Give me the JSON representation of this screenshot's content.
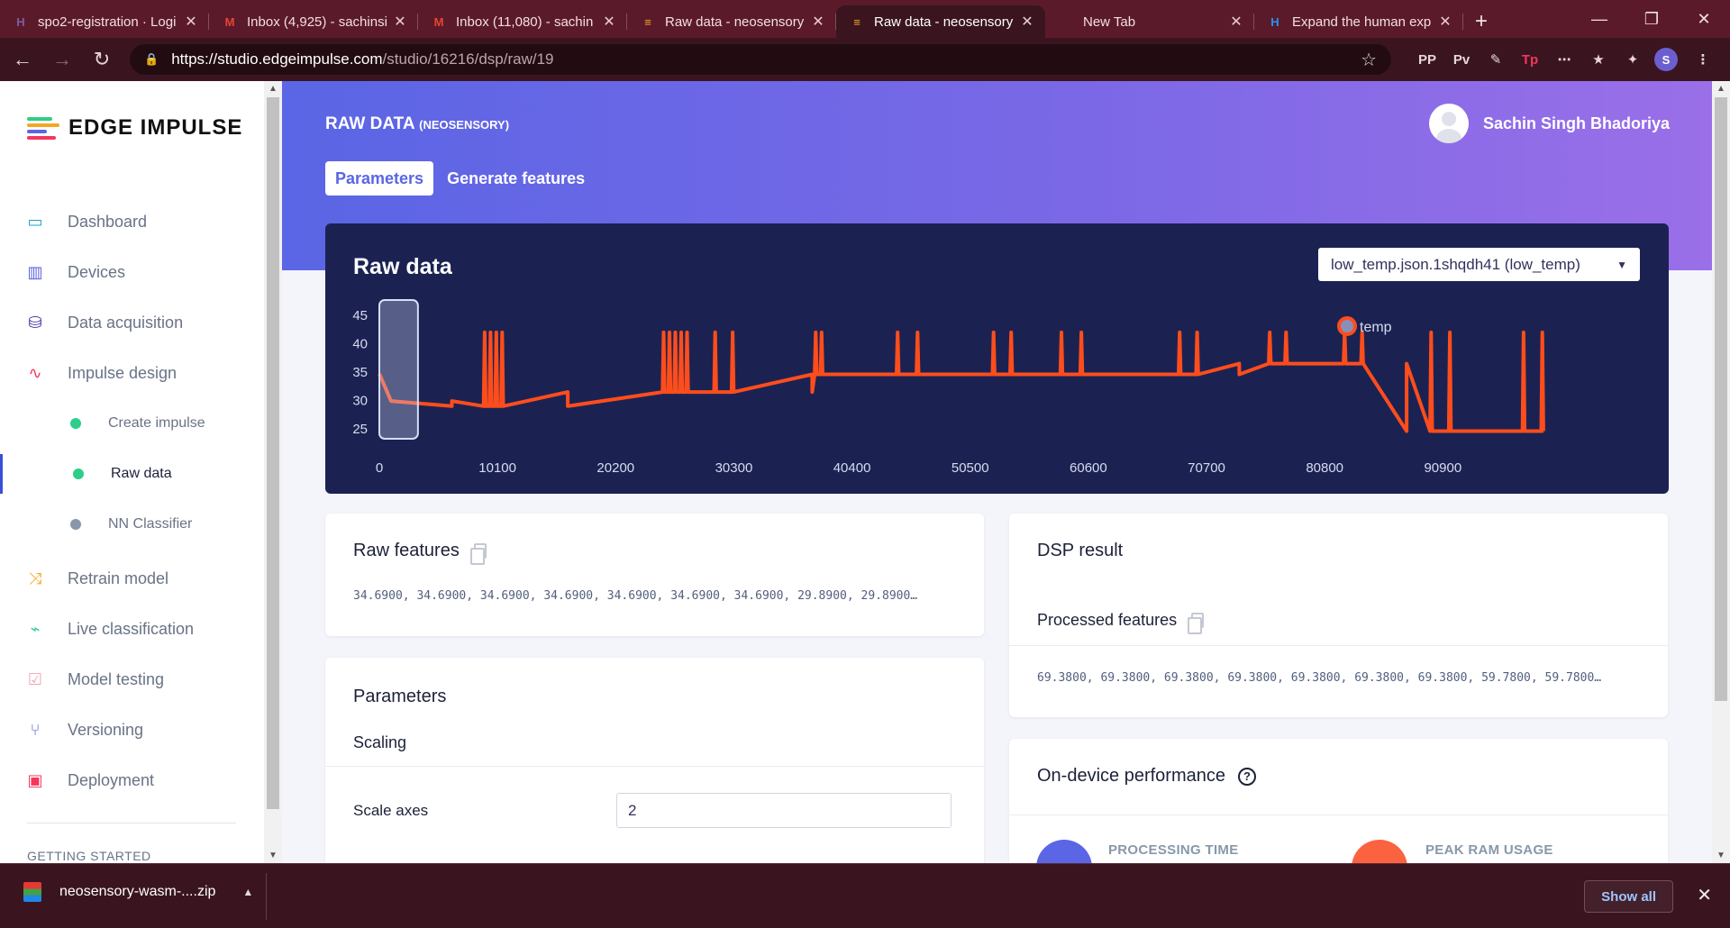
{
  "browser": {
    "tabs": [
      {
        "title": "spo2-registration · Logi",
        "favicon": "H",
        "fav_color": "#7b5ea7"
      },
      {
        "title": "Inbox (4,925) - sachinsi",
        "favicon": "M",
        "fav_color": "#ea4335"
      },
      {
        "title": "Inbox (11,080) - sachin",
        "favicon": "M",
        "fav_color": "#ea4335"
      },
      {
        "title": "Raw data - neosensory",
        "favicon": "≡",
        "fav_color": "#f5a623"
      },
      {
        "title": "Raw data - neosensory",
        "favicon": "≡",
        "fav_color": "#f5a623",
        "active": true
      },
      {
        "title": "New Tab",
        "favicon": "",
        "fav_color": ""
      },
      {
        "title": "Expand the human exp",
        "favicon": "H",
        "fav_color": "#2196f3"
      }
    ],
    "url_host": "https://studio.edgeimpulse.com",
    "url_path": "/studio/16216/dsp/raw/19",
    "extensions": [
      "PP",
      "Pv",
      "✎",
      "Tp",
      "⋯",
      "★",
      "✦"
    ],
    "profile_initial": "S"
  },
  "sidebar": {
    "brand": "EDGE IMPULSE",
    "items": [
      {
        "label": "Dashboard",
        "icon": "monitor-icon",
        "color": "#1aa3c8"
      },
      {
        "label": "Devices",
        "icon": "chip-icon",
        "color": "#5a5ee0"
      },
      {
        "label": "Data acquisition",
        "icon": "database-icon",
        "color": "#3b2fa0"
      },
      {
        "label": "Impulse design",
        "icon": "pulse-icon",
        "color": "#f5365c"
      }
    ],
    "sub_items": [
      {
        "label": "Create impulse",
        "dot": "#2dce89"
      },
      {
        "label": "Raw data",
        "dot": "#2dce89",
        "active": true
      },
      {
        "label": "NN Classifier",
        "dot": "#8898aa"
      }
    ],
    "items2": [
      {
        "label": "Retrain model",
        "icon": "shuffle-icon",
        "color": "#f5a623"
      },
      {
        "label": "Live classification",
        "icon": "signal-icon",
        "color": "#2dce89"
      },
      {
        "label": "Model testing",
        "icon": "clipboard-icon",
        "color": "#f3a4b5"
      },
      {
        "label": "Versioning",
        "icon": "branch-icon",
        "color": "#5a5ee0"
      },
      {
        "label": "Deployment",
        "icon": "box-icon",
        "color": "#f5365c"
      }
    ],
    "section_label": "GETTING STARTED"
  },
  "header": {
    "title": "RAW DATA",
    "project": "(NEOSENSORY)",
    "user_name": "Sachin Singh Bhadoriya",
    "tabs": [
      "Parameters",
      "Generate features"
    ]
  },
  "raw_card": {
    "title": "Raw data",
    "sample_select": "low_temp.json.1shqdh41 (low_temp)"
  },
  "chart_data": {
    "type": "line",
    "title": "Raw data",
    "xlabel": "",
    "ylabel": "",
    "xlim": [
      0,
      99500
    ],
    "ylim": [
      22,
      45
    ],
    "x_ticks": [
      0,
      10100,
      20200,
      30300,
      40400,
      50500,
      60600,
      70700,
      80800,
      90900
    ],
    "y_ticks": [
      25,
      30,
      35,
      40,
      45
    ],
    "legend": "right",
    "grid": false,
    "window": {
      "x_start": 0,
      "x_end": 3300
    },
    "series": [
      {
        "name": "temp",
        "color": "#fd4d1c",
        "baseline": [
          [
            0,
            34.7
          ],
          [
            1000,
            29.9
          ],
          [
            6200,
            29.9
          ],
          [
            6200,
            29.0
          ],
          [
            16100,
            29.0
          ],
          [
            16100,
            31.5
          ],
          [
            37000,
            31.5
          ],
          [
            37000,
            34.6
          ],
          [
            73500,
            34.6
          ],
          [
            73500,
            36.5
          ],
          [
            87800,
            36.5
          ],
          [
            87800,
            24.6
          ],
          [
            99500,
            24.6
          ]
        ],
        "spikes": [
          9000,
          9500,
          10000,
          10500,
          24300,
          24800,
          25300,
          25800,
          26300,
          28700,
          30200,
          37300,
          37800,
          44300,
          46000,
          52500,
          54000,
          58300,
          60000,
          68400,
          69900,
          76100,
          77500,
          82500,
          84000,
          89900,
          91500,
          97800,
          99400
        ],
        "spike_peak": 42.0
      }
    ]
  },
  "raw_features": {
    "title": "Raw features",
    "values": "34.6900, 34.6900, 34.6900, 34.6900, 34.6900, 34.6900, 34.6900, 29.8900, 29.8900…"
  },
  "parameters": {
    "title": "Parameters",
    "section": "Scaling",
    "scale_axes_label": "Scale axes",
    "scale_axes_value": "2"
  },
  "dsp_result": {
    "title": "DSP result",
    "processed_title": "Processed features",
    "values": "69.3800, 69.3800, 69.3800, 69.3800, 69.3800, 69.3800, 69.3800, 59.7800, 59.7800…"
  },
  "performance": {
    "title": "On-device performance",
    "processing_label": "PROCESSING TIME",
    "ram_label": "PEAK RAM USAGE"
  },
  "downloads": {
    "file": "neosensory-wasm-....zip",
    "show_all": "Show all"
  }
}
